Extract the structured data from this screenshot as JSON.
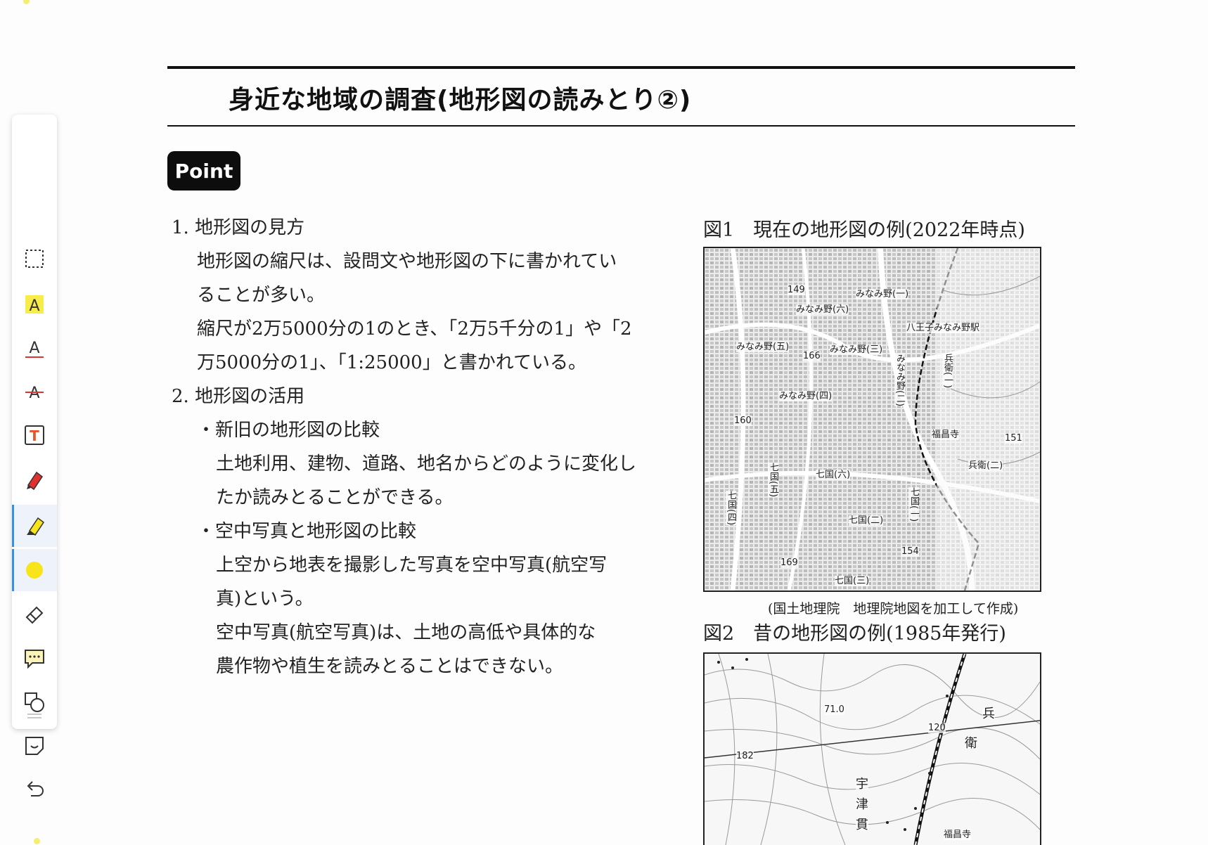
{
  "toolbar": {
    "tools": [
      {
        "name": "select-tool",
        "icon": "dashed-rectangle-icon"
      },
      {
        "name": "highlight-text-tool",
        "icon": "text-highlight-icon"
      },
      {
        "name": "underline-tool",
        "icon": "text-underline-icon"
      },
      {
        "name": "strikethrough-tool",
        "icon": "text-strikethrough-icon"
      },
      {
        "name": "text-box-tool",
        "icon": "text-box-icon"
      },
      {
        "name": "pen-tool",
        "icon": "pen-icon"
      },
      {
        "name": "highlighter-tool",
        "icon": "highlighter-icon",
        "active": true
      },
      {
        "name": "color-picker",
        "icon": "color-dot-icon",
        "color": "#f7e41a"
      },
      {
        "name": "eraser-tool",
        "icon": "eraser-icon"
      },
      {
        "name": "comment-tool",
        "icon": "comment-icon"
      },
      {
        "name": "shape-tool",
        "icon": "shapes-icon"
      },
      {
        "name": "sticker-tool",
        "icon": "sticker-icon"
      },
      {
        "name": "undo-button",
        "icon": "undo-icon"
      }
    ],
    "accent_color": "#3b8ee8"
  },
  "document": {
    "title": "身近な地域の調査(地形図の読みとり②)",
    "badge": "Point",
    "sections": [
      {
        "heading": "1. 地形図の見方",
        "lines": [
          "地形図の縮尺は、設問文や地形図の下に書かれてい",
          "ることが多い。",
          "縮尺が2万5000分の1のとき、「2万5千分の1」や「2",
          "万5000分の1」、「1:25000」と書かれている。"
        ]
      },
      {
        "heading": "2. 地形図の活用",
        "bullets": [
          {
            "label": "・新旧の地形図の比較",
            "lines": [
              "土地利用、建物、道路、地名からどのように変化し",
              "たか読みとることができる。"
            ]
          },
          {
            "label": "・空中写真と地形図の比較",
            "lines": [
              "上空から地表を撮影した写真を空中写真(航空写",
              "真)という。",
              "空中写真(航空写真)は、土地の高低や具体的な",
              "農作物や植生を読みとることはできない。"
            ]
          }
        ]
      }
    ],
    "figure1": {
      "caption": "図1　現在の地形図の例(2022年時点)",
      "credit": "(国土地理院　地理院地図を加工して作成)",
      "labels": [
        "149",
        "みなみ野(一)",
        "みなみ野(六)",
        "八王子みなみ野駅",
        "みなみ野(五)",
        "166",
        "みなみ野(三)",
        "兵衛(一)",
        "みなみ野(四)",
        "みなみ野(二)",
        "160",
        "福昌寺",
        "151",
        "兵衛(二)",
        "七国(六)",
        "七国(五)",
        "七国(四)",
        "七国(一)",
        "七国(二)",
        "154",
        "169",
        "七国(三)"
      ]
    },
    "figure2": {
      "caption": "図2　昔の地形図の例(1985年発行)",
      "labels": [
        "71.0",
        "182",
        "120",
        "兵",
        "衛",
        "宇",
        "津",
        "貫",
        "福昌寺"
      ]
    }
  }
}
